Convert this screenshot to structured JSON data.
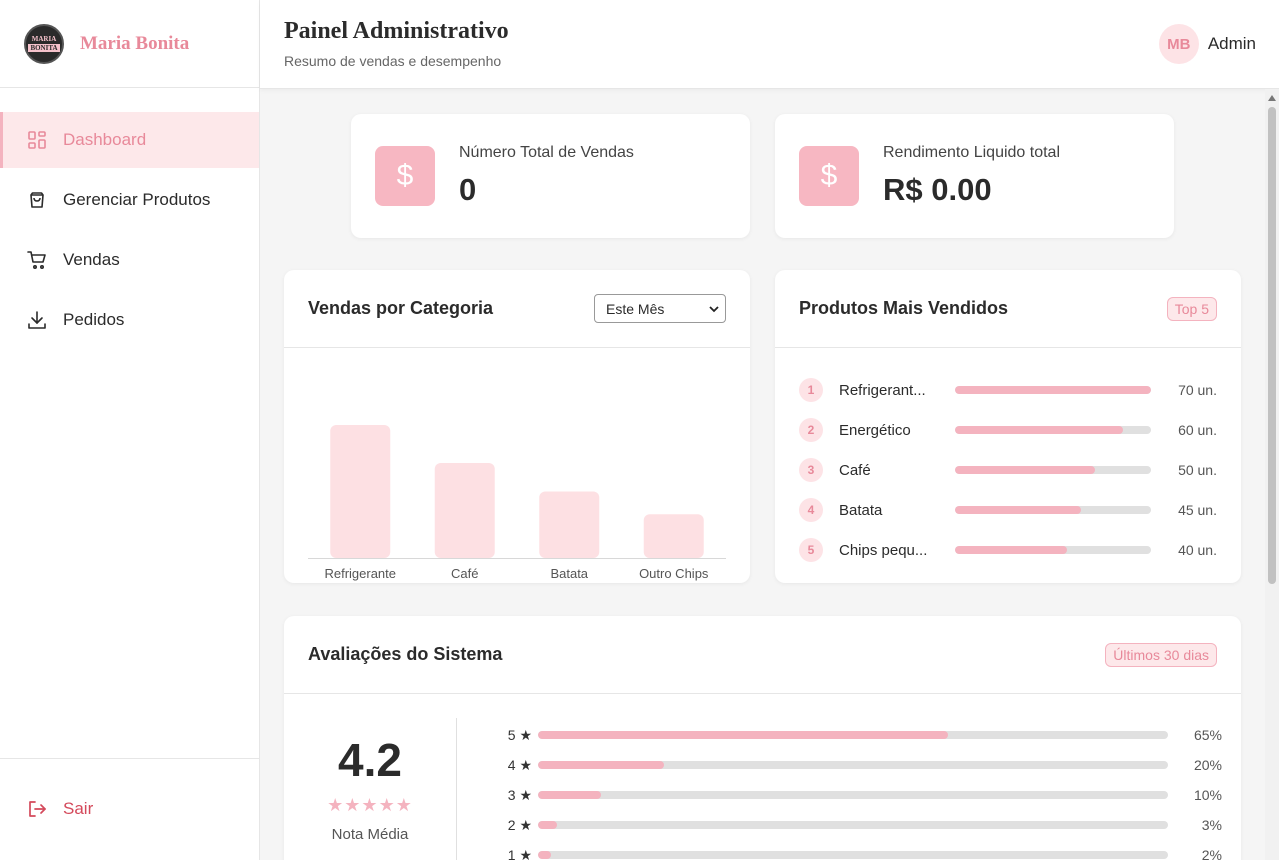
{
  "brand": {
    "name": "Maria Bonita",
    "logo_line1": "MARIA",
    "logo_line2": "BONITA"
  },
  "nav": [
    {
      "label": "Dashboard",
      "icon": "grid-icon",
      "active": true
    },
    {
      "label": "Gerenciar Produtos",
      "icon": "bag-icon",
      "active": false
    },
    {
      "label": "Vendas",
      "icon": "cart-icon",
      "active": false
    },
    {
      "label": "Pedidos",
      "icon": "download-icon",
      "active": false
    }
  ],
  "logout_label": "Sair",
  "header": {
    "title": "Painel Administrativo",
    "subtitle": "Resumo de vendas e desempenho",
    "avatar_initials": "MB",
    "user_name": "Admin"
  },
  "stats": [
    {
      "label": "Número Total de Vendas",
      "value": "0",
      "icon": "dollar-icon"
    },
    {
      "label": "Rendimento Liquido total",
      "value": "R$ 0.00",
      "icon": "dollar-icon"
    }
  ],
  "category_card": {
    "title": "Vendas por Categoria",
    "period_selected": "Este Mês"
  },
  "chart_data": {
    "type": "bar",
    "categories": [
      "Refrigerante",
      "Café",
      "Batata",
      "Outro Chips"
    ],
    "values": [
      70,
      50,
      35,
      23
    ],
    "ylim": [
      0,
      100
    ],
    "title": "",
    "xlabel": "",
    "ylabel": "",
    "grid": false,
    "bar_color": "#fde0e3"
  },
  "top_products": {
    "title": "Produtos Mais Vendidos",
    "badge": "Top 5",
    "items": [
      {
        "rank": "1",
        "name": "Refrigerant...",
        "qty": "70 un.",
        "share": 1.0
      },
      {
        "rank": "2",
        "name": "Energético",
        "qty": "60 un.",
        "share": 0.857
      },
      {
        "rank": "3",
        "name": "Café",
        "qty": "50 un.",
        "share": 0.714
      },
      {
        "rank": "4",
        "name": "Batata",
        "qty": "45 un.",
        "share": 0.643
      },
      {
        "rank": "5",
        "name": "Chips pequ...",
        "qty": "40 un.",
        "share": 0.571
      }
    ]
  },
  "ratings": {
    "title": "Avaliações do Sistema",
    "badge": "Últimos 30 dias",
    "average": "4.2",
    "stars": "★★★★★",
    "caption": "Nota Média",
    "rows": [
      {
        "label": "5 ★",
        "pct": "65%",
        "value": 0.65
      },
      {
        "label": "4 ★",
        "pct": "20%",
        "value": 0.2
      },
      {
        "label": "3 ★",
        "pct": "10%",
        "value": 0.1
      },
      {
        "label": "2 ★",
        "pct": "3%",
        "value": 0.03
      },
      {
        "label": "1 ★",
        "pct": "2%",
        "value": 0.02
      }
    ]
  },
  "colors": {
    "accent": "#e8899a",
    "accent_soft": "#f4b3bf",
    "accent_bg": "#fde8ea",
    "danger": "#d4495b"
  }
}
